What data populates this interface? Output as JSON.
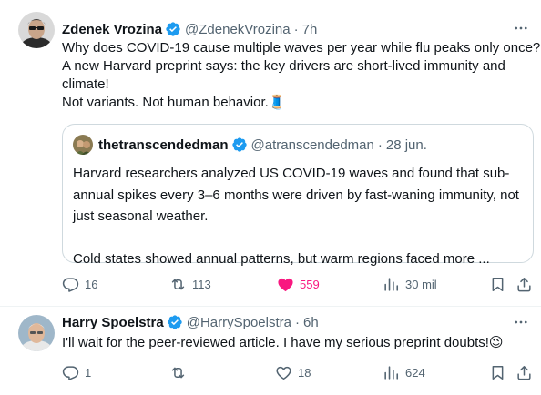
{
  "tweets": [
    {
      "author_name": "Zdenek Vrozina",
      "handle": "@ZdenekVrozina",
      "separator": "·",
      "time": "7h",
      "text_lines": [
        "Why does COVID-19 cause multiple waves per year while flu peaks only once?",
        "A new Harvard preprint says: the key drivers are short-lived immunity and",
        "climate!",
        "Not variants. Not human behavior.🧵"
      ],
      "quote": {
        "author_name": "thetranscendedman",
        "handle": "@atranscendedman",
        "separator": "·",
        "date": "28 jun.",
        "text_lines": [
          "Harvard researchers analyzed US COVID-19 waves and found that sub-",
          "annual spikes every 3–6 months were driven by fast-waning immunity, not",
          "just seasonal weather.",
          "",
          "Cold states showed annual patterns, but warm regions faced more ..."
        ]
      },
      "stats": {
        "replies": "16",
        "reposts": "113",
        "likes": "559",
        "views": "30 mil"
      },
      "liked": true
    },
    {
      "author_name": "Harry Spoelstra",
      "handle": "@HarrySpoelstra",
      "separator": "·",
      "time": "6h",
      "text_lines": [
        "I'll wait for the peer-reviewed article. I have my serious preprint doubts!😉"
      ],
      "stats": {
        "replies": "1",
        "reposts": "",
        "likes": "18",
        "views": "624"
      },
      "liked": false
    }
  ],
  "colors": {
    "text": "#0f1419",
    "secondary": "#536471",
    "verified": "#1d9bf0",
    "like": "#f91880",
    "border": "#cfd9de",
    "divider": "#eff3f4"
  },
  "icons": [
    "more-icon",
    "verified-icon",
    "reply-icon",
    "repost-icon",
    "like-icon",
    "views-icon",
    "bookmark-icon",
    "share-icon"
  ]
}
